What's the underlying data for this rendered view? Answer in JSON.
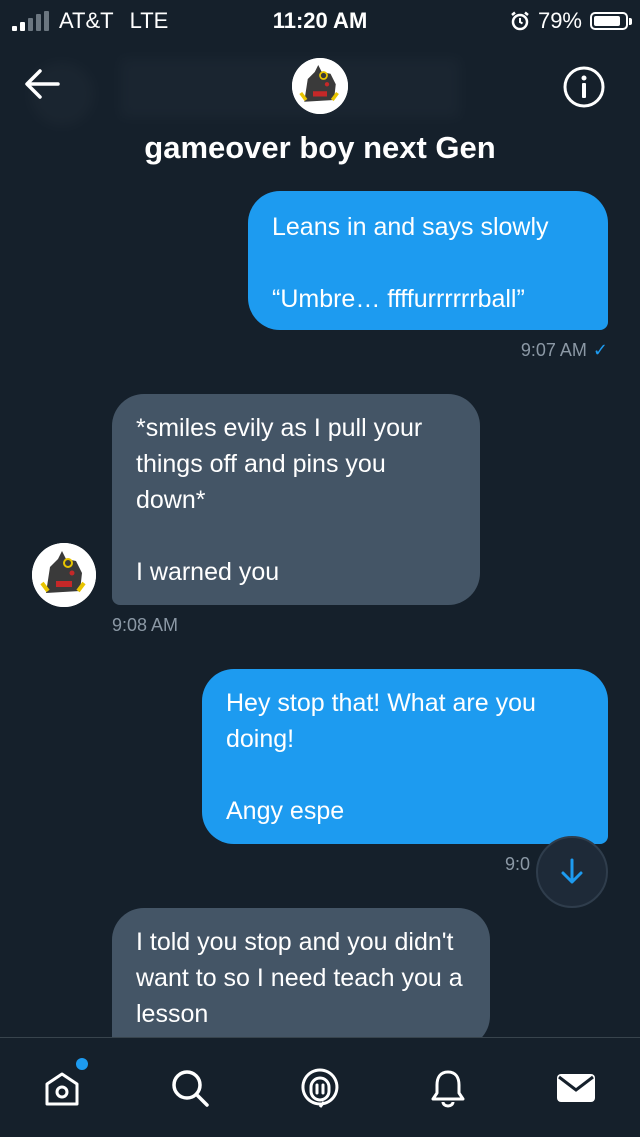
{
  "status_bar": {
    "carrier": "AT&T",
    "network": "LTE",
    "time": "11:20 AM",
    "battery": "79%",
    "icons": [
      "signal-icon",
      "alarm-icon",
      "battery-icon"
    ]
  },
  "header": {
    "title": "gameover boy next Gen",
    "back_icon": "arrow-left-icon",
    "info_icon": "info-icon"
  },
  "messages": [
    {
      "side": "sent",
      "text": "Leans in and says slowly\n\n“Umbre… ffffurrrrrrball”",
      "time": "9:07 AM",
      "status_icon": "check-icon"
    },
    {
      "side": "received",
      "text": "*smiles evily as I pull your things off and pins you down*\n\nI warned you",
      "time": "9:08 AM"
    },
    {
      "side": "sent",
      "text": "Hey stop that! What are you doing!\n\nAngy espe",
      "time": "9:0"
    },
    {
      "side": "received",
      "text": "I told you stop and you didn't want to so I need teach you a lesson"
    }
  ],
  "scroll_button_icon": "arrow-down-icon",
  "tabbar": {
    "items": [
      "home-icon",
      "search-icon",
      "spaces-icon",
      "notifications-icon",
      "messages-icon"
    ],
    "accent": "#1d9bf0"
  },
  "colors": {
    "background": "#15202b",
    "sent_bubble": "#1d9bf0",
    "received_bubble": "#445566",
    "meta_text": "#8b98a5"
  }
}
